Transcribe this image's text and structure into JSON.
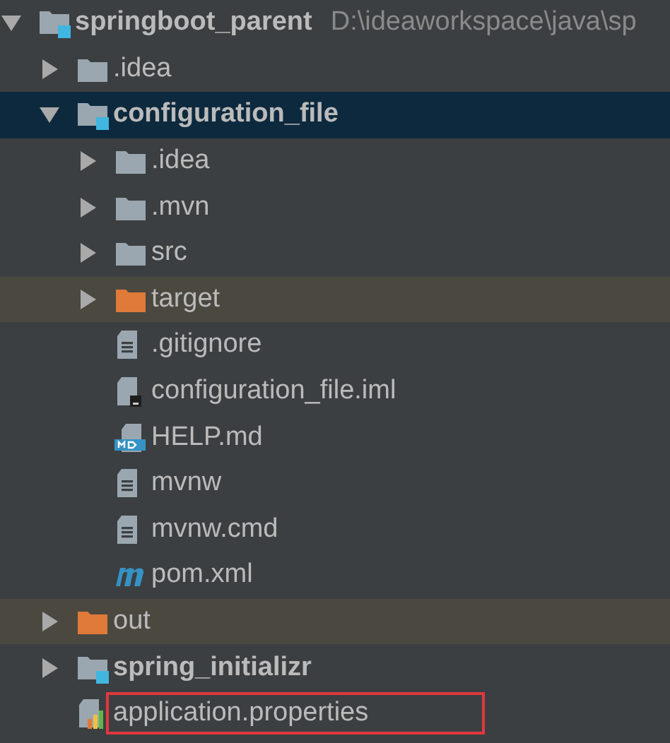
{
  "tree": [
    {
      "label": "springboot_parent",
      "path": "D:\\ideaworkspace\\java\\sp",
      "kind": "module",
      "expanded": true,
      "selected": false,
      "outlined": false,
      "children": [
        {
          "label": ".idea",
          "kind": "folder",
          "expanded": false,
          "selected": false,
          "outlined": false
        },
        {
          "label": "configuration_file",
          "kind": "module",
          "expanded": true,
          "selected": true,
          "outlined": false,
          "children": [
            {
              "label": ".idea",
              "kind": "folder",
              "expanded": false,
              "selected": false,
              "outlined": false
            },
            {
              "label": ".mvn",
              "kind": "folder",
              "expanded": false,
              "selected": false,
              "outlined": false
            },
            {
              "label": "src",
              "kind": "folder",
              "expanded": false,
              "selected": false,
              "outlined": false
            },
            {
              "label": "target",
              "kind": "excluded",
              "expanded": false,
              "selected": false,
              "outlined": false
            },
            {
              "label": ".gitignore",
              "kind": "textfile",
              "selected": false,
              "outlined": false
            },
            {
              "label": "configuration_file.iml",
              "kind": "imlfile",
              "selected": false,
              "outlined": false
            },
            {
              "label": "HELP.md",
              "kind": "markdown",
              "selected": false,
              "outlined": false
            },
            {
              "label": "mvnw",
              "kind": "textfile",
              "selected": false,
              "outlined": false
            },
            {
              "label": "mvnw.cmd",
              "kind": "textfile",
              "selected": false,
              "outlined": false
            },
            {
              "label": "pom.xml",
              "kind": "maven",
              "selected": false,
              "outlined": false
            }
          ]
        },
        {
          "label": "out",
          "kind": "excluded",
          "expanded": false,
          "selected": false,
          "outlined": false
        },
        {
          "label": "spring_initializr",
          "kind": "module",
          "expanded": false,
          "selected": false,
          "outlined": false
        },
        {
          "label": "application.properties",
          "kind": "properties",
          "selected": false,
          "outlined": true
        }
      ]
    }
  ]
}
